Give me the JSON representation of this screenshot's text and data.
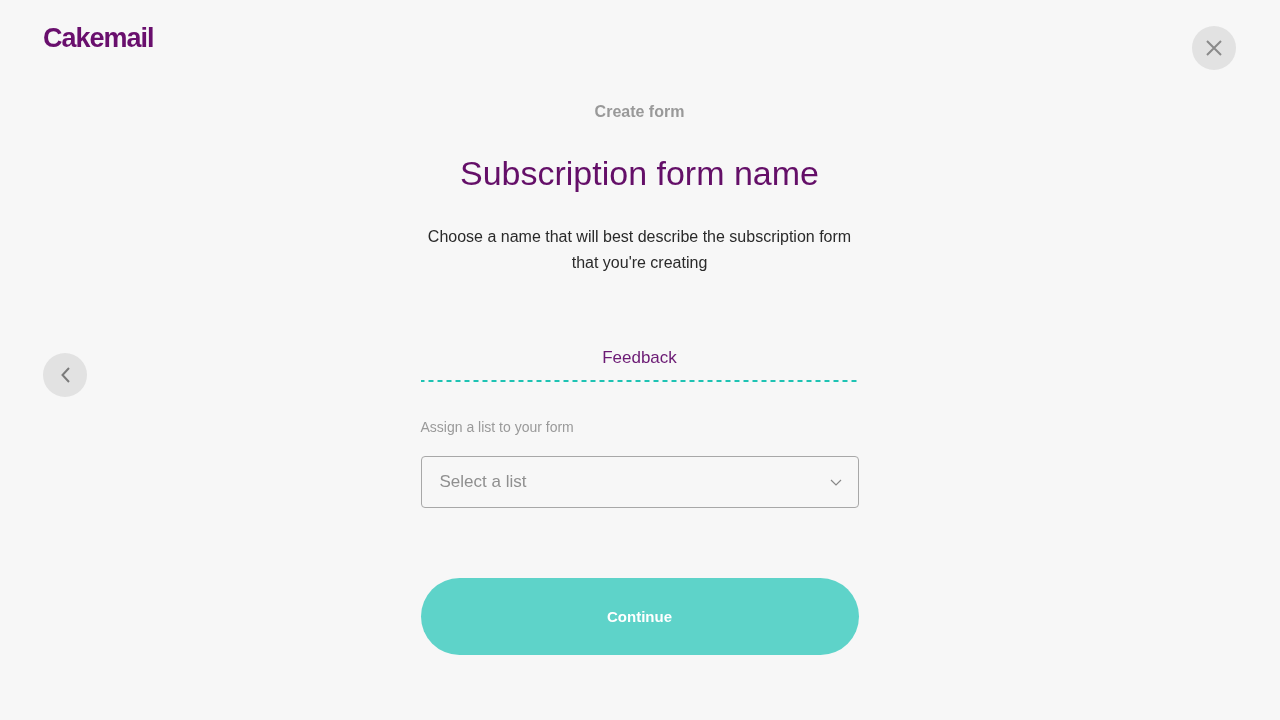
{
  "logo": "Cakemail",
  "step": "Create form",
  "title": "Subscription form name",
  "description": "Choose a name that will best describe the subscription form that you're creating",
  "name_field": {
    "value": "Feedback"
  },
  "list_field": {
    "label": "Assign a list to your form",
    "placeholder": "Select a list"
  },
  "continue_button": {
    "label": "Continue"
  }
}
